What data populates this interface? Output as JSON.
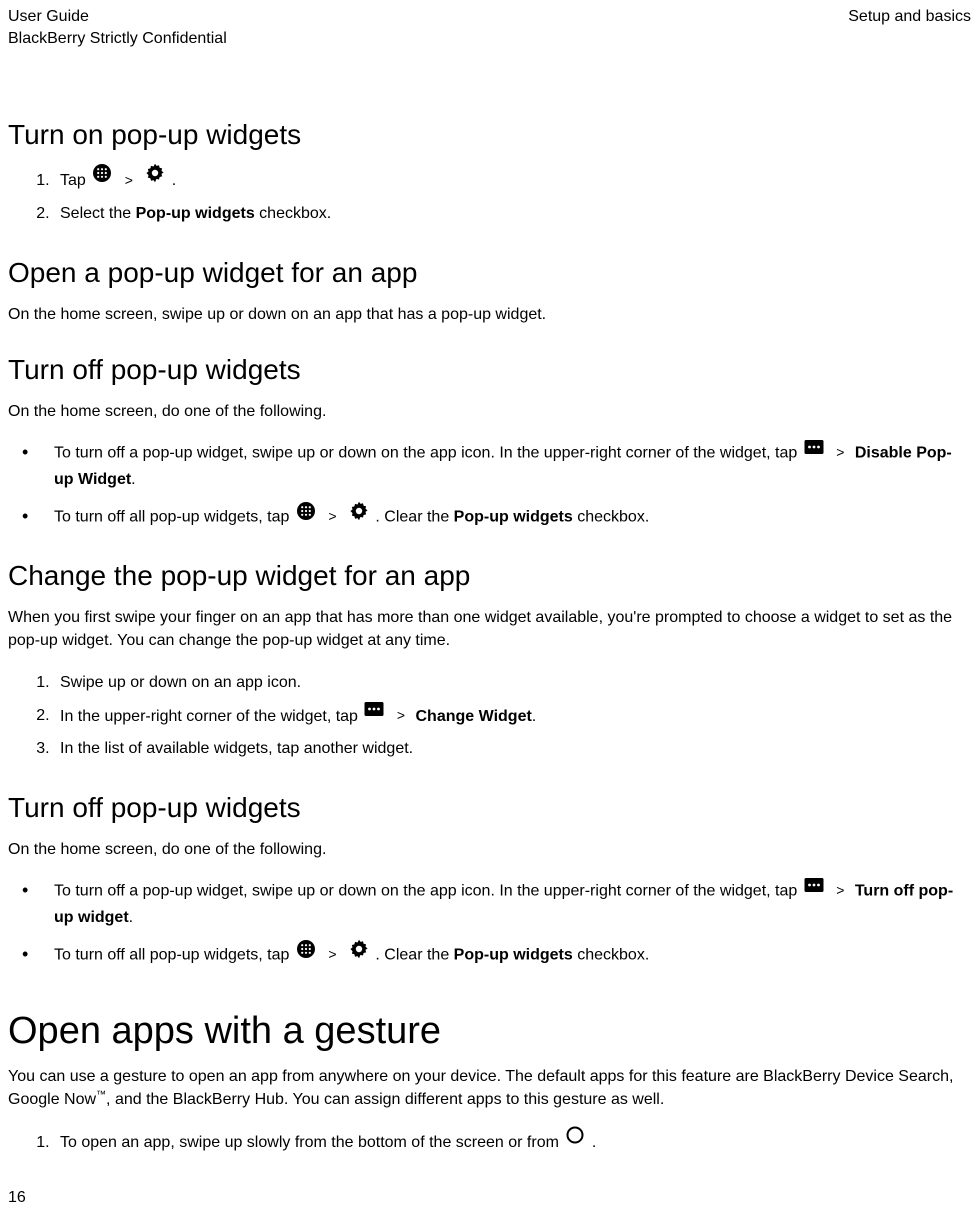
{
  "header": {
    "left1": "User Guide",
    "left2": "BlackBerry Strictly Confidential",
    "right1": "Setup and basics"
  },
  "icons": {
    "apps": "apps-icon",
    "gear": "gear-icon",
    "more": "more-icon",
    "circle": "circle-icon"
  },
  "sec1": {
    "title": "Turn on pop-up widgets",
    "step1_pre": "Tap ",
    "step1_post": " .",
    "step2_pre": "Select the ",
    "step2_bold": "Pop-up widgets",
    "step2_post": " checkbox."
  },
  "sec2": {
    "title": "Open a pop-up widget for an app",
    "body": "On the home screen, swipe up or down on an app that has a pop-up widget."
  },
  "sec3": {
    "title": "Turn off pop-up widgets",
    "intro": "On the home screen, do one of the following.",
    "b1_pre": "To turn off a pop-up widget, swipe up or down on the app icon. In the upper-right corner of the widget, tap ",
    "b1_bold": "Disable Pop-up Widget",
    "b1_post": ".",
    "b2_pre": "To turn off all pop-up widgets, tap ",
    "b2_mid": " . Clear the ",
    "b2_bold": "Pop-up widgets",
    "b2_post": " checkbox."
  },
  "sec4": {
    "title": "Change the pop-up widget for an app",
    "intro": "When you first swipe your finger on an app that has more than one widget available, you're prompted to choose a widget to set as the pop-up widget. You can change the pop-up widget at any time.",
    "s1": "Swipe up or down on an app icon.",
    "s2_pre": "In the upper-right corner of the widget, tap ",
    "s2_bold": "Change Widget",
    "s2_post": ".",
    "s3": "In the list of available widgets, tap another widget."
  },
  "sec5": {
    "title": "Turn off pop-up widgets",
    "intro": "On the home screen, do one of the following.",
    "b1_pre": "To turn off a pop-up widget, swipe up or down on the app icon. In the upper-right corner of the widget, tap ",
    "b1_bold": "Turn off pop-up widget",
    "b1_post": ".",
    "b2_pre": "To turn off all pop-up widgets, tap ",
    "b2_mid": " . Clear the ",
    "b2_bold": "Pop-up widgets",
    "b2_post": " checkbox."
  },
  "sec6": {
    "title": "Open apps with a gesture",
    "intro_a": "You can use a gesture to open an app from anywhere on your device. The default apps for this feature are BlackBerry Device Search, Google Now",
    "intro_tm": "™",
    "intro_b": ", and the BlackBerry Hub. You can assign different apps to this gesture as well.",
    "s1_pre": "To open an app, swipe up slowly from the bottom of the screen or from ",
    "s1_post": " ."
  },
  "gt": ">",
  "pagenum": "16"
}
